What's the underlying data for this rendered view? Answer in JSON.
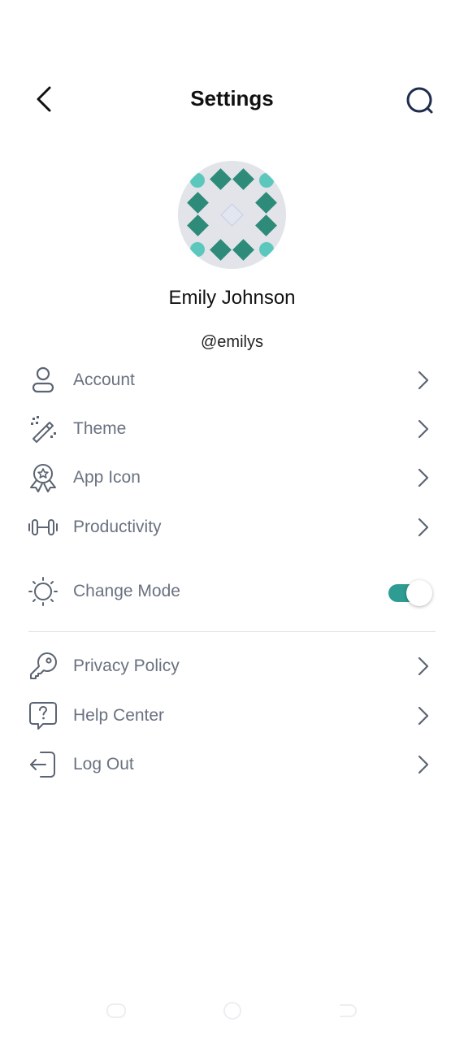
{
  "header": {
    "title": "Settings",
    "back_icon": "chevron-left-icon",
    "search_icon": "search-icon"
  },
  "profile": {
    "name": "Emily Johnson",
    "handle": "@emilys",
    "avatar_icon": "identicon-avatar"
  },
  "menu": {
    "account": {
      "label": "Account",
      "icon": "user-icon"
    },
    "theme": {
      "label": "Theme",
      "icon": "magic-wand-icon"
    },
    "app_icon": {
      "label": "App Icon",
      "icon": "badge-award-icon"
    },
    "productivity": {
      "label": "Productivity",
      "icon": "dumbbell-icon"
    },
    "change_mode": {
      "label": "Change Mode",
      "icon": "sun-icon",
      "toggle_on": true
    },
    "privacy_policy": {
      "label": "Privacy Policy",
      "icon": "key-icon"
    },
    "help_center": {
      "label": "Help Center",
      "icon": "question-chat-icon"
    },
    "log_out": {
      "label": "Log Out",
      "icon": "logout-icon"
    }
  },
  "colors": {
    "accent": "#2e9c92",
    "avatar_teal_dark": "#2e8b7a",
    "avatar_teal_light": "#5cc8bd",
    "label_gray": "#6a7280",
    "icon_gray": "#5b6472",
    "search_navy": "#1f2d4d"
  },
  "navbar": {
    "recents_icon": "recents-icon",
    "home_icon": "home-icon",
    "back_icon": "back-nav-icon"
  }
}
